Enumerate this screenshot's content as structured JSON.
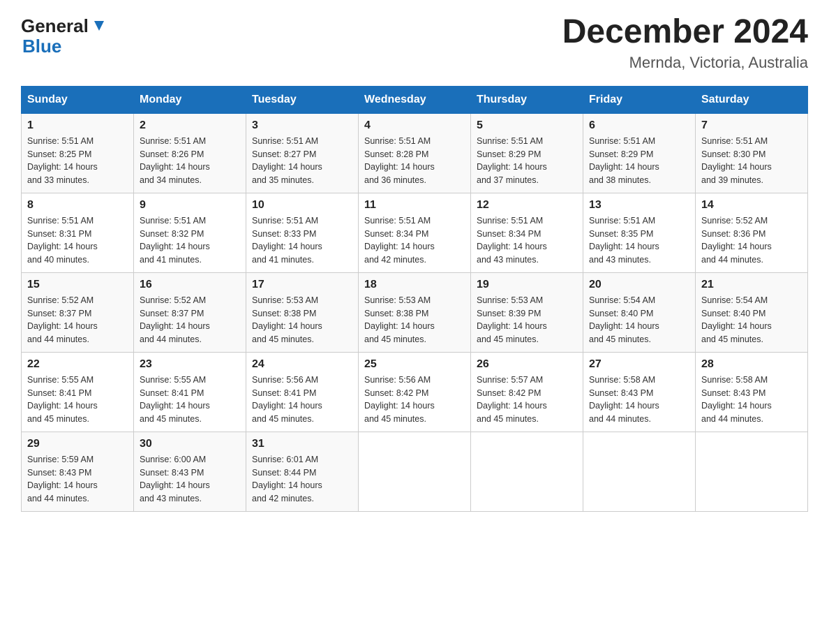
{
  "header": {
    "logo_general": "General",
    "logo_blue": "Blue",
    "title": "December 2024",
    "subtitle": "Mernda, Victoria, Australia"
  },
  "days_of_week": [
    "Sunday",
    "Monday",
    "Tuesday",
    "Wednesday",
    "Thursday",
    "Friday",
    "Saturday"
  ],
  "weeks": [
    [
      {
        "day": "1",
        "sunrise": "5:51 AM",
        "sunset": "8:25 PM",
        "daylight": "14 hours and 33 minutes."
      },
      {
        "day": "2",
        "sunrise": "5:51 AM",
        "sunset": "8:26 PM",
        "daylight": "14 hours and 34 minutes."
      },
      {
        "day": "3",
        "sunrise": "5:51 AM",
        "sunset": "8:27 PM",
        "daylight": "14 hours and 35 minutes."
      },
      {
        "day": "4",
        "sunrise": "5:51 AM",
        "sunset": "8:28 PM",
        "daylight": "14 hours and 36 minutes."
      },
      {
        "day": "5",
        "sunrise": "5:51 AM",
        "sunset": "8:29 PM",
        "daylight": "14 hours and 37 minutes."
      },
      {
        "day": "6",
        "sunrise": "5:51 AM",
        "sunset": "8:29 PM",
        "daylight": "14 hours and 38 minutes."
      },
      {
        "day": "7",
        "sunrise": "5:51 AM",
        "sunset": "8:30 PM",
        "daylight": "14 hours and 39 minutes."
      }
    ],
    [
      {
        "day": "8",
        "sunrise": "5:51 AM",
        "sunset": "8:31 PM",
        "daylight": "14 hours and 40 minutes."
      },
      {
        "day": "9",
        "sunrise": "5:51 AM",
        "sunset": "8:32 PM",
        "daylight": "14 hours and 41 minutes."
      },
      {
        "day": "10",
        "sunrise": "5:51 AM",
        "sunset": "8:33 PM",
        "daylight": "14 hours and 41 minutes."
      },
      {
        "day": "11",
        "sunrise": "5:51 AM",
        "sunset": "8:34 PM",
        "daylight": "14 hours and 42 minutes."
      },
      {
        "day": "12",
        "sunrise": "5:51 AM",
        "sunset": "8:34 PM",
        "daylight": "14 hours and 43 minutes."
      },
      {
        "day": "13",
        "sunrise": "5:51 AM",
        "sunset": "8:35 PM",
        "daylight": "14 hours and 43 minutes."
      },
      {
        "day": "14",
        "sunrise": "5:52 AM",
        "sunset": "8:36 PM",
        "daylight": "14 hours and 44 minutes."
      }
    ],
    [
      {
        "day": "15",
        "sunrise": "5:52 AM",
        "sunset": "8:37 PM",
        "daylight": "14 hours and 44 minutes."
      },
      {
        "day": "16",
        "sunrise": "5:52 AM",
        "sunset": "8:37 PM",
        "daylight": "14 hours and 44 minutes."
      },
      {
        "day": "17",
        "sunrise": "5:53 AM",
        "sunset": "8:38 PM",
        "daylight": "14 hours and 45 minutes."
      },
      {
        "day": "18",
        "sunrise": "5:53 AM",
        "sunset": "8:38 PM",
        "daylight": "14 hours and 45 minutes."
      },
      {
        "day": "19",
        "sunrise": "5:53 AM",
        "sunset": "8:39 PM",
        "daylight": "14 hours and 45 minutes."
      },
      {
        "day": "20",
        "sunrise": "5:54 AM",
        "sunset": "8:40 PM",
        "daylight": "14 hours and 45 minutes."
      },
      {
        "day": "21",
        "sunrise": "5:54 AM",
        "sunset": "8:40 PM",
        "daylight": "14 hours and 45 minutes."
      }
    ],
    [
      {
        "day": "22",
        "sunrise": "5:55 AM",
        "sunset": "8:41 PM",
        "daylight": "14 hours and 45 minutes."
      },
      {
        "day": "23",
        "sunrise": "5:55 AM",
        "sunset": "8:41 PM",
        "daylight": "14 hours and 45 minutes."
      },
      {
        "day": "24",
        "sunrise": "5:56 AM",
        "sunset": "8:41 PM",
        "daylight": "14 hours and 45 minutes."
      },
      {
        "day": "25",
        "sunrise": "5:56 AM",
        "sunset": "8:42 PM",
        "daylight": "14 hours and 45 minutes."
      },
      {
        "day": "26",
        "sunrise": "5:57 AM",
        "sunset": "8:42 PM",
        "daylight": "14 hours and 45 minutes."
      },
      {
        "day": "27",
        "sunrise": "5:58 AM",
        "sunset": "8:43 PM",
        "daylight": "14 hours and 44 minutes."
      },
      {
        "day": "28",
        "sunrise": "5:58 AM",
        "sunset": "8:43 PM",
        "daylight": "14 hours and 44 minutes."
      }
    ],
    [
      {
        "day": "29",
        "sunrise": "5:59 AM",
        "sunset": "8:43 PM",
        "daylight": "14 hours and 44 minutes."
      },
      {
        "day": "30",
        "sunrise": "6:00 AM",
        "sunset": "8:43 PM",
        "daylight": "14 hours and 43 minutes."
      },
      {
        "day": "31",
        "sunrise": "6:01 AM",
        "sunset": "8:44 PM",
        "daylight": "14 hours and 42 minutes."
      },
      null,
      null,
      null,
      null
    ]
  ],
  "labels": {
    "sunrise": "Sunrise:",
    "sunset": "Sunset:",
    "daylight": "Daylight:"
  }
}
